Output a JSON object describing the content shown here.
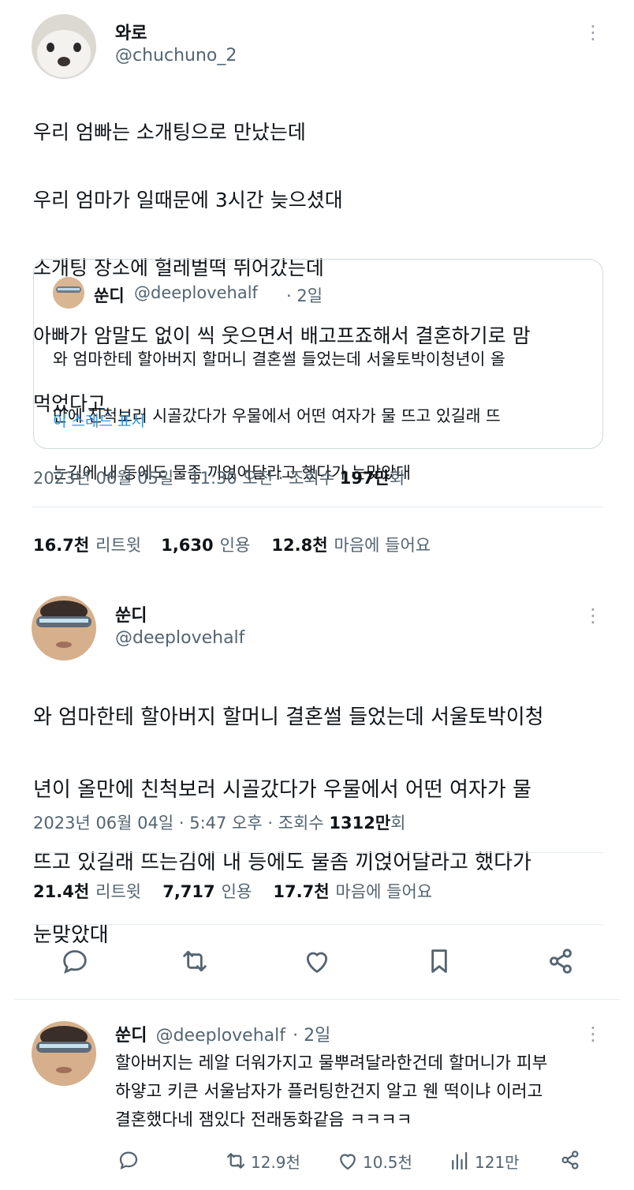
{
  "tweet1": {
    "name": "와로",
    "handle": "@chuchuno_2",
    "lines": [
      "우리 엄빠는 소개팅으로 만났는데",
      "우리 엄마가 일때문에 3시간 늦으셨대",
      "소개팅 장소에 헐레벌떡 뛰어갔는데",
      "아빠가 암말도 없이 씩 웃으면서 배고프죠해서 결혼하기로 맘",
      "먹었다고"
    ],
    "quote": {
      "name": "쑨디",
      "handle": "@deeplovehalf",
      "time": "· 2일",
      "lines": [
        "와 엄마한테 할아버지 할머니 결혼썰 들었는데 서울토박이청년이 올",
        "만에 친척보러 시골갔다가 우물에서 어떤 여자가 물 뜨고 있길래 뜨",
        "는김에 내 등에도 물좀 끼얹어달라고 했다가 눈맞았대"
      ],
      "show_thread": "이 스레드 표시"
    },
    "meta_prefix": "2023년 06월 05일 · 11:30 오전 · 조회수 ",
    "views_num": "197",
    "views_unit": "만",
    "views_suffix": "회",
    "stats": [
      {
        "num": "16.7천",
        "label": "리트윗"
      },
      {
        "num": "1,630",
        "label": "인용"
      },
      {
        "num": "12.8천",
        "label": "마음에 들어요"
      }
    ]
  },
  "tweet2": {
    "name": "쑨디",
    "handle": "@deeplovehalf",
    "lines": [
      "와 엄마한테 할아버지 할머니 결혼썰 들었는데 서울토박이청",
      "년이 올만에 친척보러 시골갔다가 우물에서 어떤 여자가 물",
      "뜨고 있길래 뜨는김에 내 등에도 물좀 끼얹어달라고 했다가",
      "눈맞았대"
    ],
    "meta_prefix": "2023년 06월 04일 · 5:47 오후 · 조회수 ",
    "views_num": "1312",
    "views_unit": "만",
    "views_suffix": "회",
    "stats": [
      {
        "num": "21.4천",
        "label": "리트윗"
      },
      {
        "num": "7,717",
        "label": "인용"
      },
      {
        "num": "17.7천",
        "label": "마음에 들어요"
      }
    ]
  },
  "reply": {
    "name": "쑨디",
    "handle": "@deeplovehalf",
    "time": "· 2일",
    "lines": [
      "할아버지는 레알 더워가지고 물뿌려달라한건데 할머니가 피부",
      "하얗고 키큰 서울남자가 플러팅한건지 알고 웬 떡이냐 이러고",
      "결혼했다네 잼있다 전래동화같음 ㅋㅋㅋㅋ"
    ],
    "retweets": "12.9천",
    "likes": "10.5천",
    "views": "121만"
  },
  "icons": [
    "reply-icon",
    "retweet-icon",
    "like-icon",
    "bookmark-icon",
    "share-icon",
    "views-icon",
    "more-icon"
  ],
  "colors": {
    "text": "#0f1419",
    "secondary": "#536471",
    "link": "#1d9bf0",
    "border": "#cfd9de"
  }
}
